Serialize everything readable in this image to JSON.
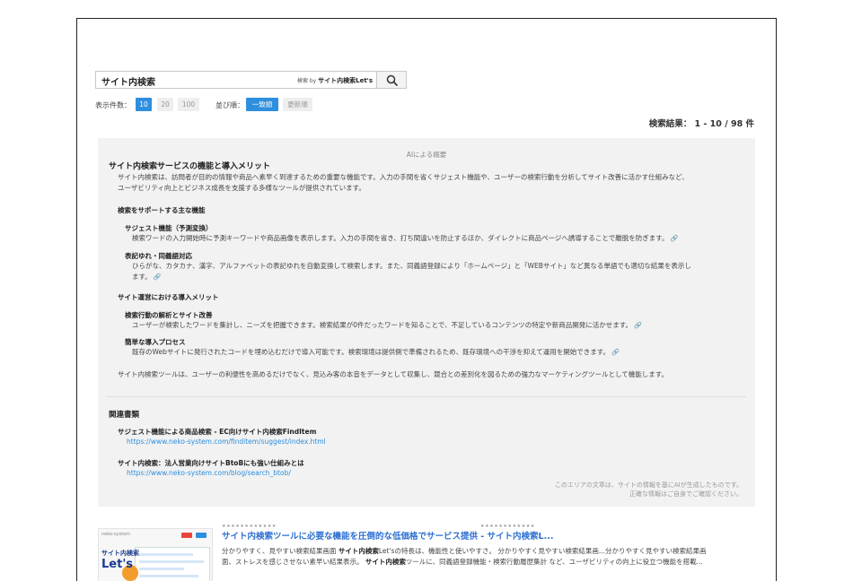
{
  "search": {
    "query": "サイト内検索",
    "brand_prefix": "検索 by ",
    "brand_name": "サイト内検索Let's"
  },
  "controls": {
    "per_page_label": "表示件数：",
    "per_page_options": [
      "10",
      "20",
      "100"
    ],
    "sort_label": "並び順：",
    "sort_options": [
      "一致順",
      "更新順"
    ]
  },
  "result_count": "検索結果： 1 - 10 / 98 件",
  "ai": {
    "header": "AIによる概要",
    "title": "サイト内検索サービスの機能と導入メリット",
    "intro": [
      "サイト内検索は、訪問者が目的の情報や商品へ素早く到達するための重要な機能です。入力の手間を省くサジェスト機能や、ユーザーの検索行動を分析してサイト改善に活かす仕組みなど、",
      "ユーザビリティ向上とビジネス成長を支援する多様なツールが提供されています。"
    ],
    "section1": "検索をサポートする主な機能",
    "item1_title": "サジェスト機能（予測変換）",
    "item1_text": "検索ワードの入力開始時に予測キーワードや商品画像を表示します。入力の手間を省き、打ち間違いを防止するほか、ダイレクトに商品ページへ誘導することで離脱を防ぎます。",
    "item2_title": "表記ゆれ・同義語対応",
    "item2_text": [
      "ひらがな、カタカナ、漢字、アルファベットの表記ゆれを自動変換して検索します。また、同義語登録により「ホームページ」と「WEBサイト」など異なる単語でも適切な結果を表示し",
      "ます。"
    ],
    "section2": "サイト運営における導入メリット",
    "item3_title": "検索行動の解析とサイト改善",
    "item3_text": "ユーザーが検索したワードを集計し、ニーズを把握できます。検索結果が0件だったワードを知ることで、不足しているコンテンツの特定や新商品開発に活かせます。",
    "item4_title": "簡単な導入プロセス",
    "item4_text": "既存のWebサイトに発行されたコードを埋め込むだけで導入可能です。検索環境は提供側で準備されるため、既存環境への干渉を抑えて運用を開始できます。",
    "summary": "サイト内検索ツールは、ユーザーの利便性を高めるだけでなく、見込み客の本音をデータとして収集し、競合との差別化を図るための強力なマーケティングツールとして機能します。",
    "related_title": "関連書類",
    "related": [
      {
        "title": "サジェスト機能による商品検索 - EC向けサイト内検索FindItem",
        "url": "https://www.neko-system.com/finditem/suggest/index.html"
      },
      {
        "title": "サイト内検索：法人営業向けサイトBtoBにも強い仕組みとは",
        "url": "https://www.neko-system.com/blog/search_btob/"
      }
    ],
    "disclaimer": [
      "このエリアの文章は、サイトの情報を基にAIが生成したものです。",
      "正確な情報はご自身でご確認ください。"
    ]
  },
  "result1": {
    "thumb_brand": "neko-system",
    "thumb_title_prefix": "サイト内検索",
    "thumb_title_main": "Let's",
    "stars_left": "★★★★★★★★★★★★",
    "stars_right": "★★★★★★★★★★★★",
    "title": "サイト内検索ツールに必要な機能を圧倒的な低価格でサービス提供 - サイト内検索L...",
    "snippet_line1_a": "分かりやすく、見やすい検索結果画面 ",
    "snippet_line1_b": "サイト内検索",
    "snippet_line1_c": "Let'sの特長は、機能性と使いやすさ。 分かりやすく見やすい検索結果画...分かりやすく見やすい検索結果画",
    "snippet_line2_a": "面、ストレスを感じさせない素早い結果表示。 ",
    "snippet_line2_b": "サイト内検索",
    "snippet_line2_c": "ツールに、同義語登録機能・検索行動履歴集計 など、ユーザビリティの向上に役立つ機能を搭載..."
  },
  "colors": {
    "accent": "#2d8fdd",
    "link": "#2d6fd1",
    "panel": "#f2f2f2"
  }
}
